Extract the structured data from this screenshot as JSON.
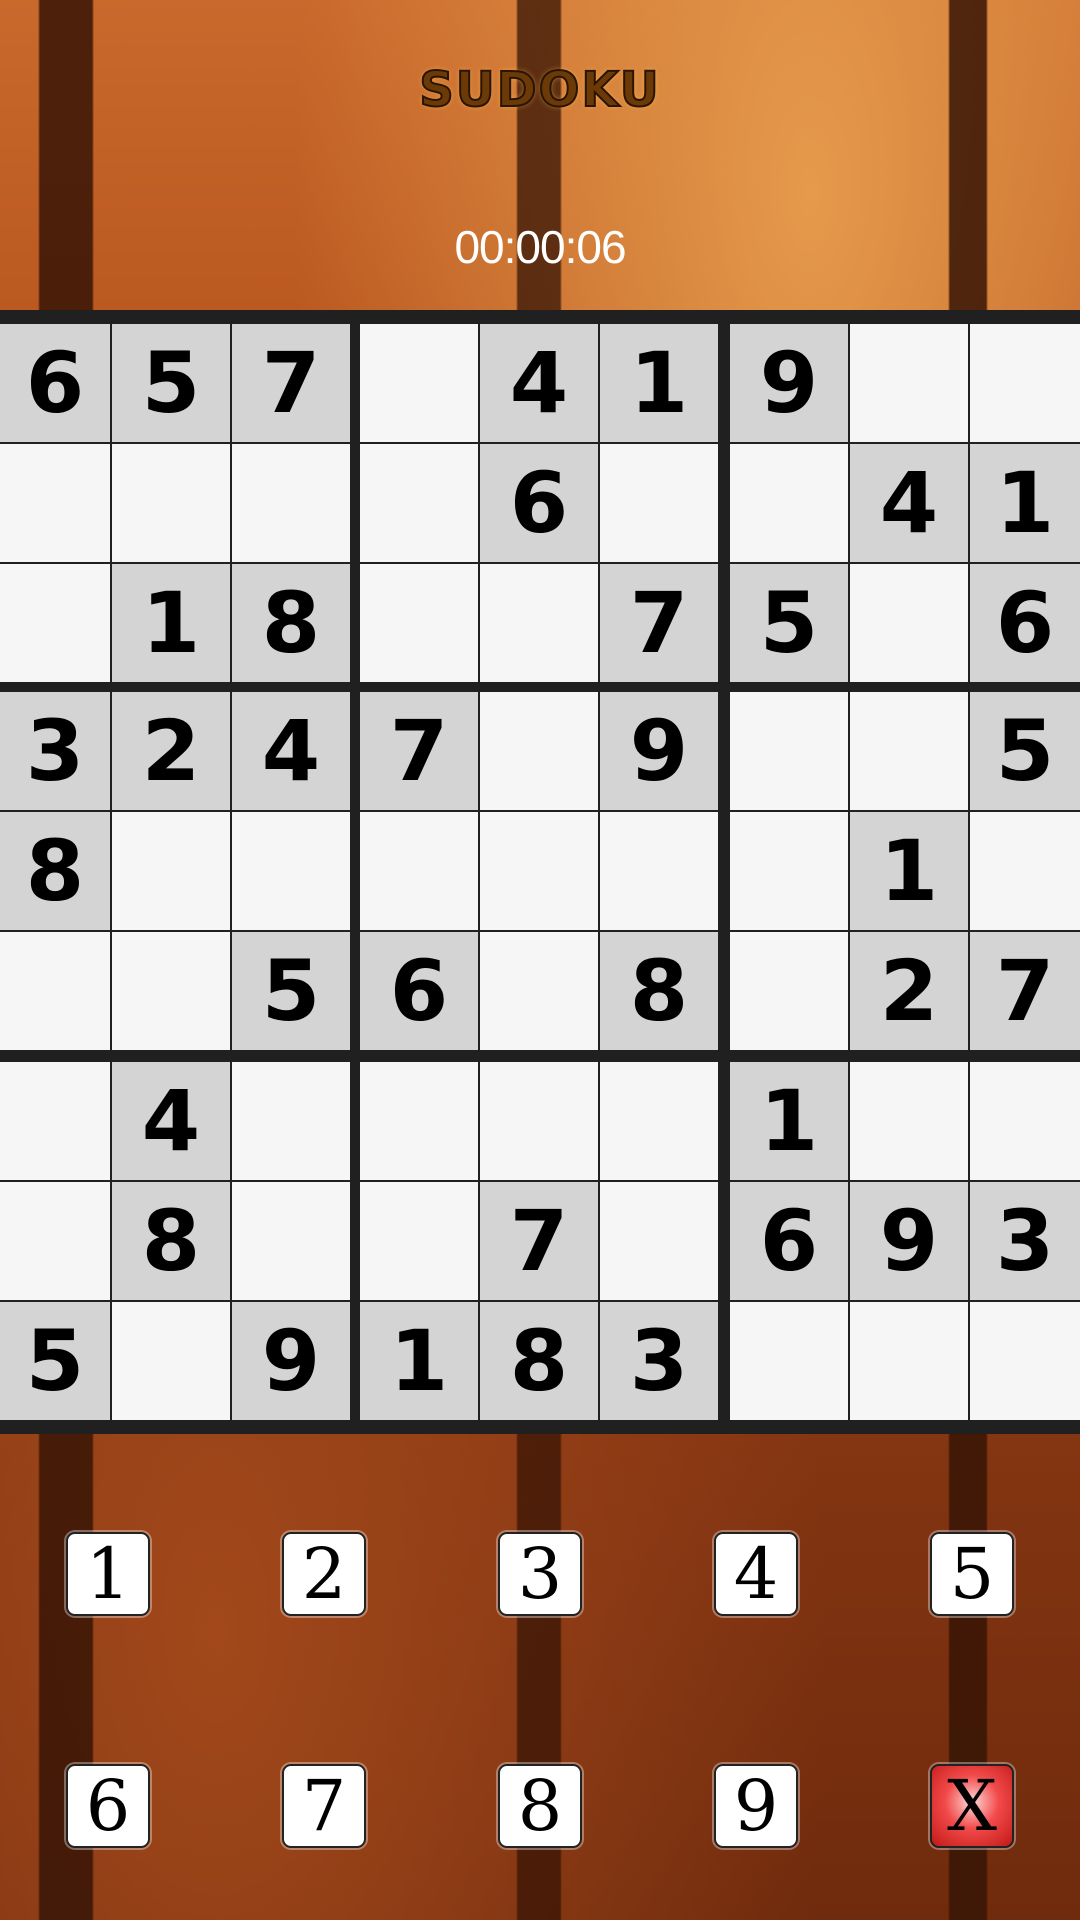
{
  "header": {
    "title": "SUDOKU",
    "timer": "00:00:06"
  },
  "board": {
    "rows": [
      [
        "6",
        "5",
        "7",
        "",
        "4",
        "1",
        "9",
        "",
        ""
      ],
      [
        "",
        "",
        "",
        "",
        "6",
        "",
        "",
        "4",
        "1"
      ],
      [
        "",
        "1",
        "8",
        "",
        "",
        "7",
        "5",
        "",
        "6"
      ],
      [
        "3",
        "2",
        "4",
        "7",
        "",
        "9",
        "",
        "",
        "5"
      ],
      [
        "8",
        "",
        "",
        "",
        "",
        "",
        "",
        "1",
        ""
      ],
      [
        "",
        "",
        "5",
        "6",
        "",
        "8",
        "",
        "2",
        "7"
      ],
      [
        "",
        "4",
        "",
        "",
        "",
        "",
        "1",
        "",
        ""
      ],
      [
        "",
        "8",
        "",
        "",
        "7",
        "",
        "6",
        "9",
        "3"
      ],
      [
        "5",
        "",
        "9",
        "1",
        "8",
        "3",
        "",
        "",
        ""
      ]
    ]
  },
  "keypad": {
    "keys": [
      "1",
      "2",
      "3",
      "4",
      "5",
      "6",
      "7",
      "8",
      "9",
      "X"
    ]
  },
  "colors": {
    "given_cell_bg": "#d4d4d4",
    "empty_cell_bg": "#f6f6f6",
    "grid_line": "#202020",
    "clear_key": "#e02a2a"
  }
}
